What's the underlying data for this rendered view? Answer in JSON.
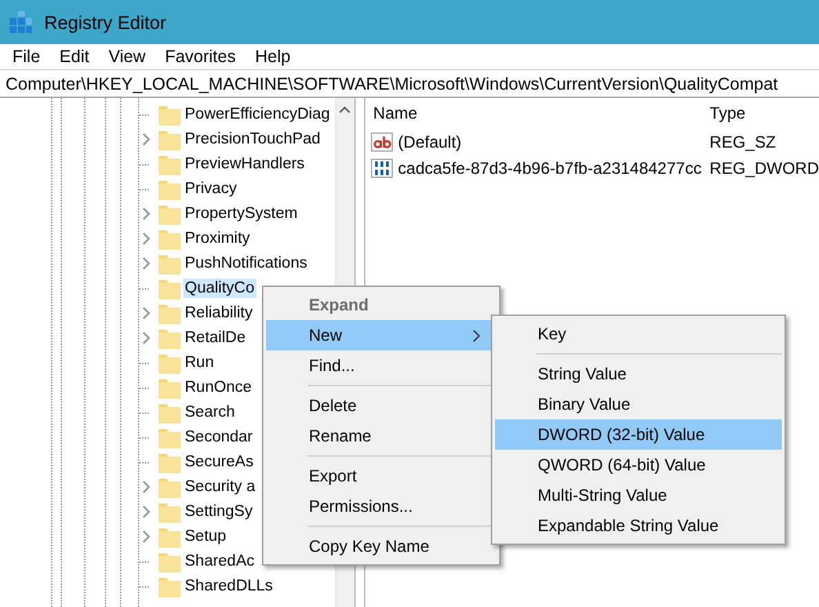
{
  "window": {
    "title": "Registry Editor"
  },
  "menu_bar": [
    "File",
    "Edit",
    "View",
    "Favorites",
    "Help"
  ],
  "address_bar": {
    "value": "Computer\\HKEY_LOCAL_MACHINE\\SOFTWARE\\Microsoft\\Windows\\CurrentVersion\\QualityCompat"
  },
  "tree": {
    "items": [
      {
        "label": "PowerEfficiencyDiag",
        "expandable": false,
        "selected": false
      },
      {
        "label": "PrecisionTouchPad",
        "expandable": true,
        "selected": false
      },
      {
        "label": "PreviewHandlers",
        "expandable": false,
        "selected": false
      },
      {
        "label": "Privacy",
        "expandable": false,
        "selected": false
      },
      {
        "label": "PropertySystem",
        "expandable": true,
        "selected": false
      },
      {
        "label": "Proximity",
        "expandable": true,
        "selected": false
      },
      {
        "label": "PushNotifications",
        "expandable": true,
        "selected": false
      },
      {
        "label": "QualityCo",
        "expandable": false,
        "selected": true
      },
      {
        "label": "Reliability",
        "expandable": true,
        "selected": false
      },
      {
        "label": "RetailDe",
        "expandable": true,
        "selected": false
      },
      {
        "label": "Run",
        "expandable": false,
        "selected": false
      },
      {
        "label": "RunOnce",
        "expandable": false,
        "selected": false
      },
      {
        "label": "Search",
        "expandable": false,
        "selected": false
      },
      {
        "label": "Secondar",
        "expandable": false,
        "selected": false
      },
      {
        "label": "SecureAs",
        "expandable": false,
        "selected": false
      },
      {
        "label": "Security a",
        "expandable": true,
        "selected": false
      },
      {
        "label": "SettingSy",
        "expandable": true,
        "selected": false
      },
      {
        "label": "Setup",
        "expandable": true,
        "selected": false
      },
      {
        "label": "SharedAc",
        "expandable": false,
        "selected": false
      },
      {
        "label": "SharedDLLs",
        "expandable": false,
        "selected": false
      }
    ]
  },
  "values": {
    "columns": [
      "Name",
      "Type"
    ],
    "rows": [
      {
        "kind": "string",
        "name": "(Default)",
        "type": "REG_SZ"
      },
      {
        "kind": "dword",
        "name": "cadca5fe-87d3-4b96-b7fb-a231484277cc",
        "type": "REG_DWORD"
      }
    ]
  },
  "context_menu": {
    "items": [
      {
        "kind": "item",
        "label": "Expand",
        "disabled": true,
        "selected": false,
        "submenu": false
      },
      {
        "kind": "item",
        "label": "New",
        "disabled": false,
        "selected": true,
        "submenu": true
      },
      {
        "kind": "item",
        "label": "Find...",
        "disabled": false,
        "selected": false,
        "submenu": false
      },
      {
        "kind": "separator"
      },
      {
        "kind": "item",
        "label": "Delete",
        "disabled": false,
        "selected": false,
        "submenu": false
      },
      {
        "kind": "item",
        "label": "Rename",
        "disabled": false,
        "selected": false,
        "submenu": false
      },
      {
        "kind": "separator"
      },
      {
        "kind": "item",
        "label": "Export",
        "disabled": false,
        "selected": false,
        "submenu": false
      },
      {
        "kind": "item",
        "label": "Permissions...",
        "disabled": false,
        "selected": false,
        "submenu": false
      },
      {
        "kind": "separator"
      },
      {
        "kind": "item",
        "label": "Copy Key Name",
        "disabled": false,
        "selected": false,
        "submenu": false
      }
    ]
  },
  "submenu": {
    "items": [
      {
        "kind": "item",
        "label": "Key",
        "selected": false
      },
      {
        "kind": "separator"
      },
      {
        "kind": "item",
        "label": "String Value",
        "selected": false
      },
      {
        "kind": "item",
        "label": "Binary Value",
        "selected": false
      },
      {
        "kind": "item",
        "label": "DWORD (32-bit) Value",
        "selected": true
      },
      {
        "kind": "item",
        "label": "QWORD (64-bit) Value",
        "selected": false
      },
      {
        "kind": "item",
        "label": "Multi-String Value",
        "selected": false
      },
      {
        "kind": "item",
        "label": "Expandable String Value",
        "selected": false
      }
    ]
  }
}
